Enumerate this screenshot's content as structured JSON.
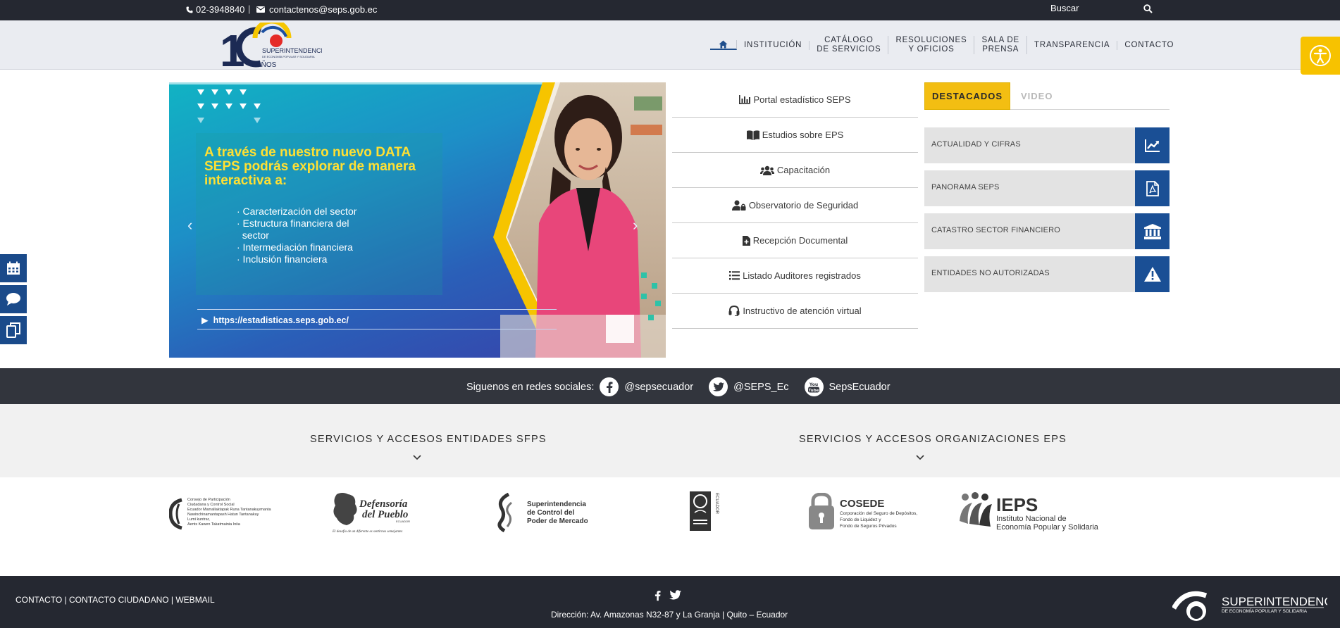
{
  "topbar": {
    "phone": "02-3948840",
    "separator": "|",
    "email": "contactenos@seps.gob.ec",
    "search_label": "Buscar"
  },
  "header": {
    "logo_text_main": "SUPERINTENDENCIA",
    "logo_text_sub": "DE ECONOMÍA POPULAR Y SOLIDARIA",
    "logo_years": "AÑOS",
    "nav": [
      {
        "label_1": "INSTITUCIÓN",
        "label_2": ""
      },
      {
        "label_1": "CATÁLOGO",
        "label_2": "DE SERVICIOS"
      },
      {
        "label_1": "RESOLUCIONES",
        "label_2": "Y OFICIOS"
      },
      {
        "label_1": "SALA DE",
        "label_2": "PRENSA"
      },
      {
        "label_1": "TRANSPARENCIA",
        "label_2": ""
      },
      {
        "label_1": "CONTACTO",
        "label_2": ""
      }
    ]
  },
  "carousel": {
    "headline": "A través de nuestro nuevo DATA SEPS podrás explorar de manera interactiva a:",
    "items": [
      "· Caracterización del sector",
      "· Estructura financiera del",
      "  sector",
      "· Intermediación financiera",
      "· Inclusión financiera"
    ],
    "url": "https://estadisticas.seps.gob.ec/"
  },
  "quicklinks": [
    {
      "label": "Portal estadístico SEPS",
      "icon": "bar-chart-icon"
    },
    {
      "label": "Estudios sobre EPS",
      "icon": "book-icon"
    },
    {
      "label": "Capacitación",
      "icon": "users-icon"
    },
    {
      "label": "Observatorio de Seguridad",
      "icon": "user-lock-icon"
    },
    {
      "label": "Recepción Documental",
      "icon": "file-plus-icon"
    },
    {
      "label": "Listado Auditores registrados",
      "icon": "list-icon"
    },
    {
      "label": "Instructivo de atención virtual",
      "icon": "headset-icon"
    }
  ],
  "destacados": {
    "tab_active": "DESTACADOS",
    "tab_other": "VIDEO",
    "items": [
      {
        "label": "ACTUALIDAD Y CIFRAS",
        "icon": "chart-line-icon"
      },
      {
        "label": "PANORAMA SEPS",
        "icon": "pdf-icon"
      },
      {
        "label": "CATASTRO SECTOR FINANCIERO",
        "icon": "bank-icon"
      },
      {
        "label": "ENTIDADES NO AUTORIZADAS",
        "icon": "warning-icon"
      }
    ]
  },
  "social": {
    "lead": "Siguenos en redes sociales:",
    "facebook": "@sepsecuador",
    "twitter": "@SEPS_Ec",
    "youtube": "SepsEcuador",
    "youtube_icon_text": "You Tube"
  },
  "services": {
    "sfps": "SERVICIOS Y ACCESOS ENTIDADES SFPS",
    "eps": "SERVICIOS Y ACCESOS ORGANIZACIONES EPS"
  },
  "logos": {
    "cpccs_lines": [
      "Consejo de Participación",
      "Ciudadana y Control Social",
      "Ecuador Mamallaktapak Runa Tantanakuymanta",
      "Nawinchinamantapash Hatun Tantanakuy",
      "Lumi kuntrar,",
      "Aents Kawen Takatmainia Iniia"
    ],
    "defensoria_1": "Defensoría",
    "defensoria_2": "del Pueblo",
    "defensoria_sub": "ECUADOR",
    "defensoria_tag": "El desafío de un diferente es sentirnos semejantes",
    "scpm_1": "Superintendencia",
    "scpm_2": "de Control del",
    "scpm_3": "Poder de Mercado",
    "contraloria": "ECUADOR",
    "cosede_title": "COSEDE",
    "cosede_1": "Corporación del Seguro de Depósitos,",
    "cosede_2": "Fondo de Liquidez y",
    "cosede_3": "Fondo de Seguros Privados",
    "ieps_title": "IEPS",
    "ieps_1": "Instituto Nacional de",
    "ieps_2": "Economía Popular y Solidaria"
  },
  "footer": {
    "links": "CONTACTO | CONTACTO CIUDADANO | WEBMAIL",
    "address": "Dirección: Av. Amazonas N32-87 y La Granja | Quito – Ecuador",
    "logo_main": "SUPERINTENDENCIA",
    "logo_sub": "DE ECONOMÍA POPULAR Y SOLIDARIA"
  },
  "colors": {
    "topbar": "#252831",
    "header": "#eaecf1",
    "accent_yellow": "#f3be12",
    "brand_blue": "#1a4f95",
    "social_bar": "#32353d"
  }
}
